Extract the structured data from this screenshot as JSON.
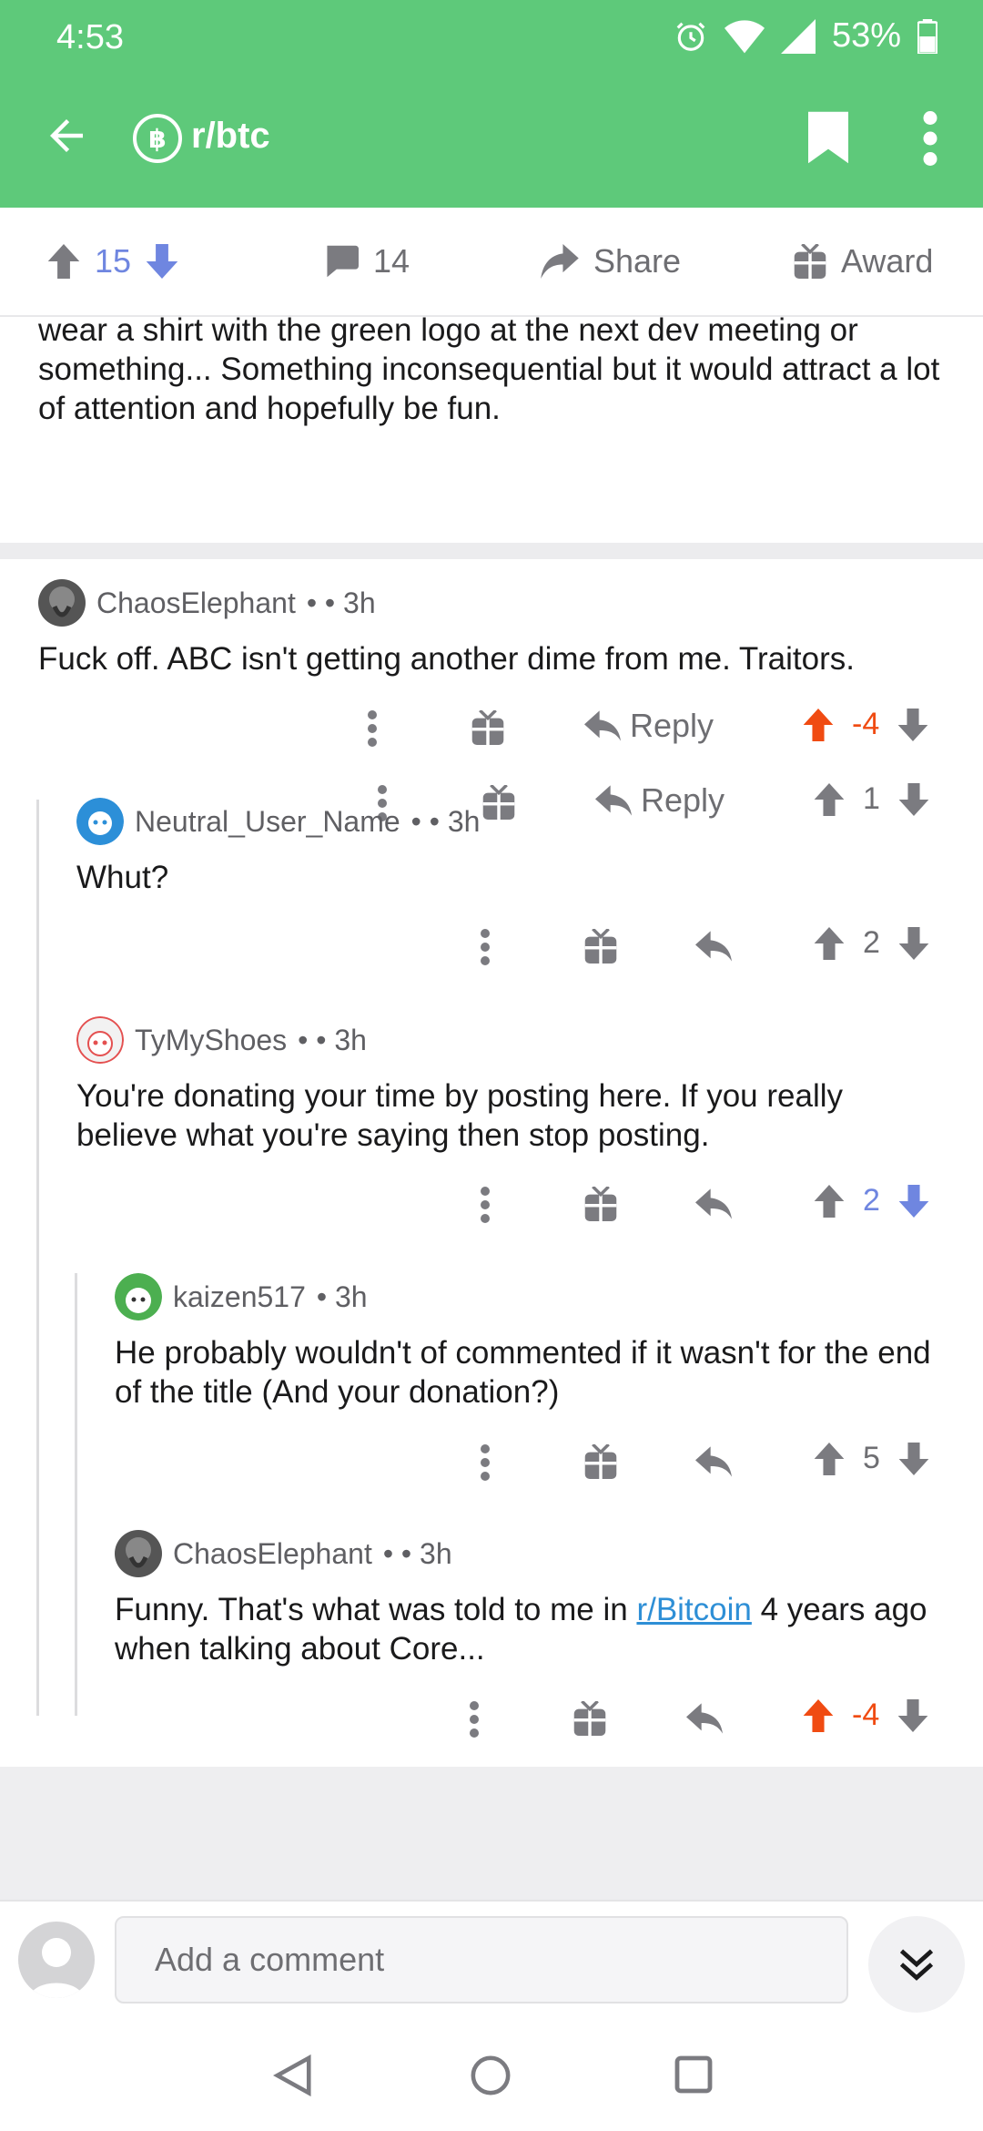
{
  "status_bar": {
    "time": "4:53",
    "battery": "53%"
  },
  "app_bar": {
    "subreddit": "r/btc",
    "sub_icon_glyph": "฿"
  },
  "post_bar": {
    "score": "15",
    "comments": "14",
    "share_label": "Share",
    "award_label": "Award"
  },
  "post_tail": {
    "text": "wear a shirt with the green logo at the next dev meeting or something... Something inconsequential but it would attract a lot of attention and hopefully be fun.",
    "reply_label": "Reply",
    "score": "1"
  },
  "comments": [
    {
      "author": "ChaosElephant",
      "meta": "• • 3h",
      "body": "Fuck off. ABC isn't getting another dime from me. Traitors.",
      "reply_label": "Reply",
      "score": "-4"
    },
    {
      "author": "Neutral_User_Name",
      "meta": "• • 3h",
      "body": "Whut?",
      "score": "2"
    },
    {
      "author": "TyMyShoes",
      "meta": "• • 3h",
      "body": "You're donating your time by posting here. If you really believe what you're saying then stop posting.",
      "score": "2"
    },
    {
      "author": "kaizen517",
      "meta": "• 3h",
      "body": "He probably wouldn't of commented if it wasn't for the end of the title (And your donation?)",
      "score": "5"
    },
    {
      "author": "ChaosElephant",
      "meta": "• • 3h",
      "body_before": "Funny. That's what was told to me in ",
      "body_link": "r/Bitcoin",
      "body_after": " 4 years ago when talking about Core...",
      "score": "-4"
    }
  ],
  "composer": {
    "placeholder": "Add a comment"
  },
  "colors": {
    "header_green": "#5ec97a",
    "upvote_orange": "#f04b12",
    "vote_blue": "#6f86e0",
    "link_blue": "#2e8fd6"
  }
}
